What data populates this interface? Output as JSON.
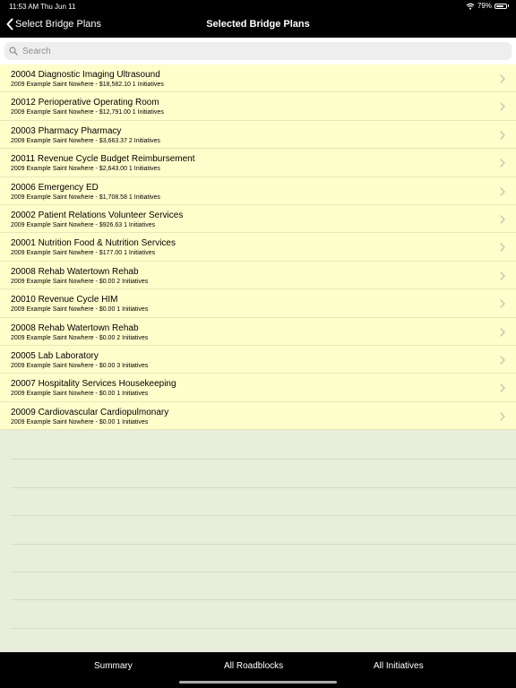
{
  "status_bar": {
    "time": "11:53 AM",
    "date": "Thu Jun 11",
    "battery_percent": "79%",
    "battery_level": 0.79
  },
  "nav": {
    "back_label": "Select Bridge Plans",
    "title": "Selected Bridge Plans"
  },
  "search": {
    "placeholder": "Search",
    "value": ""
  },
  "plans": [
    {
      "title": "20004 Diagnostic Imaging Ultrasound",
      "subtitle": "2009 Example Saint Nowhere - $18,582.10 1 Initiatives"
    },
    {
      "title": "20012 Perioperative Operating Room",
      "subtitle": "2009 Example Saint Nowhere - $12,791.00 1 Initiatives"
    },
    {
      "title": "20003 Pharmacy Pharmacy",
      "subtitle": "2009 Example Saint Nowhere - $3,663.37 2 Initiatives"
    },
    {
      "title": "20011 Revenue Cycle Budget Reimbursement",
      "subtitle": "2009 Example Saint Nowhere - $2,643.00 1 Initiatives"
    },
    {
      "title": "20006 Emergency ED",
      "subtitle": "2009 Example Saint Nowhere - $1,708.58 1 Initiatives"
    },
    {
      "title": "20002 Patient Relations Volunteer Services",
      "subtitle": "2009 Example Saint Nowhere - $926.63 1 Initiatives"
    },
    {
      "title": "20001 Nutrition Food & Nutrition Services",
      "subtitle": "2009 Example Saint Nowhere - $177.00 1 Initiatives"
    },
    {
      "title": "20008 Rehab Watertown Rehab",
      "subtitle": "2009 Example Saint Nowhere - $0.00 2 Initiatives"
    },
    {
      "title": "20010 Revenue Cycle HIM",
      "subtitle": "2009 Example Saint Nowhere - $0.00 1 Initiatives"
    },
    {
      "title": "20008 Rehab Watertown Rehab",
      "subtitle": "2009 Example Saint Nowhere - $0.00 2 Initiatives"
    },
    {
      "title": "20005 Lab Laboratory",
      "subtitle": "2009 Example Saint Nowhere - $0.00 3 Initiatives"
    },
    {
      "title": "20007 Hospitality Services Housekeeping",
      "subtitle": "2009 Example Saint Nowhere - $0.00 1 Initiatives"
    },
    {
      "title": "20009 Cardiovascular Cardiopulmonary",
      "subtitle": "2009 Example Saint Nowhere - $0.00 1 Initiatives"
    }
  ],
  "tabs": {
    "summary": "Summary",
    "roadblocks": "All Roadblocks",
    "initiatives": "All Initiatives"
  },
  "colors": {
    "row_background": "#ffffcc",
    "list_background": "#e9eddb",
    "bar_background": "#000000"
  },
  "icons": {
    "back": "chevron-left-icon",
    "search": "search-icon",
    "row": "chevron-right-icon",
    "wifi": "wifi-icon",
    "battery": "battery-icon"
  }
}
